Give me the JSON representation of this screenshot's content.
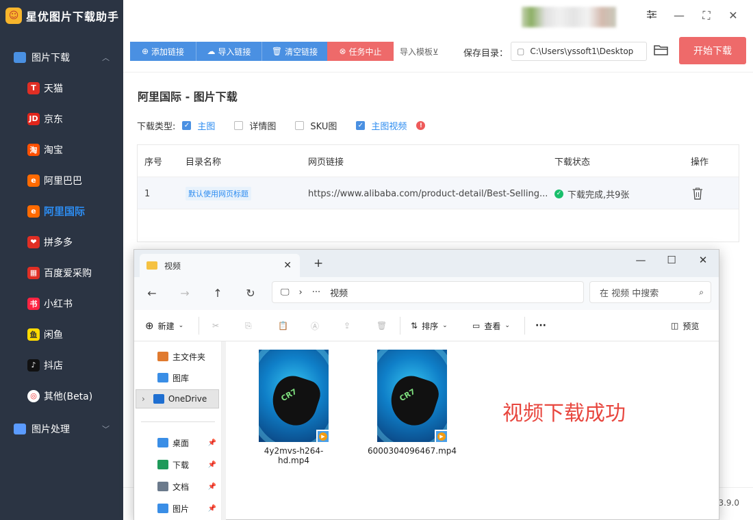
{
  "app": {
    "title": "星优图片下载助手",
    "version": "3.9.0"
  },
  "sidebar": {
    "section_download": "图片下载",
    "section_process": "图片处理",
    "items": [
      {
        "label": "天猫",
        "icon": "tmall-icon",
        "glyph": "T",
        "color": "#e02e24"
      },
      {
        "label": "京东",
        "icon": "jd-icon",
        "glyph": "JD",
        "color": "#e1251b"
      },
      {
        "label": "淘宝",
        "icon": "taobao-icon",
        "glyph": "淘",
        "color": "#ff5000"
      },
      {
        "label": "阿里巴巴",
        "icon": "alibaba-icon",
        "glyph": "e",
        "color": "#ff6a00"
      },
      {
        "label": "阿里国际",
        "icon": "alibaba-intl-icon",
        "glyph": "e",
        "color": "#ff6a00",
        "active": true
      },
      {
        "label": "拼多多",
        "icon": "pinduoduo-icon",
        "glyph": "❤",
        "color": "#e02e24"
      },
      {
        "label": "百度爱采购",
        "icon": "baidu-icon",
        "glyph": "▦",
        "color": "#e02e24"
      },
      {
        "label": "小红书",
        "icon": "xiaohongshu-icon",
        "glyph": "书",
        "color": "#ff2442"
      },
      {
        "label": "闲鱼",
        "icon": "xianyu-icon",
        "glyph": "鱼",
        "color": "#ffda00"
      },
      {
        "label": "抖店",
        "icon": "douyin-icon",
        "glyph": "♪",
        "color": "#111111"
      },
      {
        "label": "其他(Beta)",
        "icon": "chrome-icon",
        "glyph": "◎",
        "color": "#ffffff"
      }
    ]
  },
  "toolbar": {
    "add_link": "添加链接",
    "import_link": "导入链接",
    "clear_link": "清空链接",
    "stop_task": "任务中止",
    "import_template": "导入模板⊻",
    "save_dir_label": "保存目录：",
    "save_dir_value": "C:\\Users\\yssoft1\\Desktop",
    "start_download": "开始下载"
  },
  "main": {
    "page_title": "阿里国际 - 图片下载",
    "download_type_label": "下载类型:",
    "types": [
      {
        "label": "主图",
        "checked": true
      },
      {
        "label": "详情图",
        "checked": false
      },
      {
        "label": "SKU图",
        "checked": false
      },
      {
        "label": "主图视频",
        "checked": true
      }
    ],
    "table": {
      "headers": [
        "序号",
        "目录名称",
        "网页链接",
        "下载状态",
        "操作"
      ],
      "rows": [
        {
          "index": "1",
          "dir_name": "默认使用网页标题",
          "url": "https://www.alibaba.com/product-detail/Best-Selling...",
          "status": "下载完成,共9张"
        }
      ]
    }
  },
  "explorer": {
    "tab_title": "视频",
    "breadcrumb_more": "···",
    "breadcrumb_folder": "视频",
    "search_placeholder": "在 视频 中搜索",
    "cmd_new": "新建",
    "cmd_sort": "排序",
    "cmd_view": "查看",
    "cmd_more": "···",
    "cmd_preview": "预览",
    "nav": [
      {
        "label": "主文件夹",
        "icon": "home-icon"
      },
      {
        "label": "图库",
        "icon": "gallery-icon"
      },
      {
        "label": "OneDrive",
        "icon": "onedrive-icon",
        "selected": true
      },
      {
        "label": "桌面",
        "icon": "desktop-icon",
        "pinned": true
      },
      {
        "label": "下载",
        "icon": "download-icon",
        "pinned": true
      },
      {
        "label": "文档",
        "icon": "document-icon",
        "pinned": true
      },
      {
        "label": "图片",
        "icon": "pictures-icon",
        "pinned": true
      }
    ],
    "files": [
      {
        "name": "4y2mvs-h264-hd.mp4"
      },
      {
        "name": "6000304096467.mp4"
      }
    ],
    "overlay_text": "视频下载成功"
  }
}
